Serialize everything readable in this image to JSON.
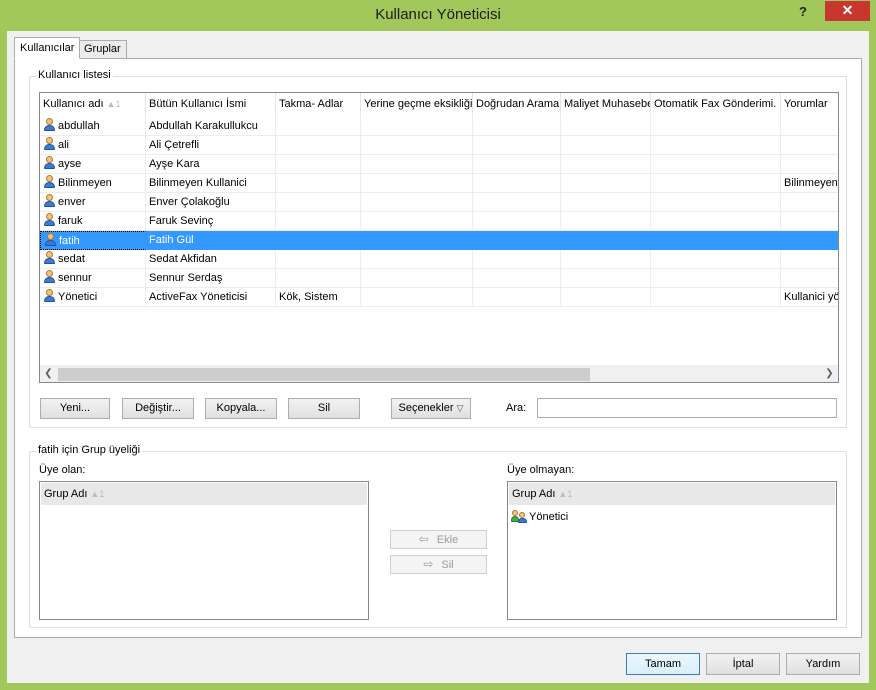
{
  "window": {
    "title": "Kullanıcı Yöneticisi",
    "help_label": "?",
    "close_label": "✕"
  },
  "tabs": [
    {
      "label": "Kullanıcılar",
      "active": true
    },
    {
      "label": "Gruplar",
      "active": false
    }
  ],
  "user_list": {
    "group_label": "Kullanıcı listesi",
    "columns": [
      "Kullanıcı adı",
      "Bütün Kullanıcı İsmi",
      "Takma- Adlar",
      "Yerine geçme eksikliği",
      "Doğrudan Arama",
      "Maliyet Muhasebe",
      "Otomatik Fax Gönderimi.",
      "Yorumlar"
    ],
    "sort_indicator": "▲1",
    "rows": [
      {
        "username": "abdullah",
        "fullname": "Abdullah Karakullukcu",
        "alias": "",
        "comment": ""
      },
      {
        "username": "ali",
        "fullname": "Ali Çetrefli",
        "alias": "",
        "comment": ""
      },
      {
        "username": "ayse",
        "fullname": "Ayşe Kara",
        "alias": "",
        "comment": ""
      },
      {
        "username": "Bilinmeyen",
        "fullname": "Bilinmeyen Kullanici",
        "alias": "",
        "comment": "Bilinmeyen k"
      },
      {
        "username": "enver",
        "fullname": "Enver Çolakoğlu",
        "alias": "",
        "comment": ""
      },
      {
        "username": "faruk",
        "fullname": "Faruk Sevinç",
        "alias": "",
        "comment": ""
      },
      {
        "username": "fatih",
        "fullname": "Fatih Gül",
        "alias": "",
        "comment": "",
        "selected": true
      },
      {
        "username": "sedat",
        "fullname": "Sedat Akfidan",
        "alias": "",
        "comment": ""
      },
      {
        "username": "sennur",
        "fullname": "Sennur Serdaş",
        "alias": "",
        "comment": ""
      },
      {
        "username": "Yönetici",
        "fullname": "ActiveFax Yöneticisi",
        "alias": "Kök, Sistem",
        "comment": "Kullanici yön"
      }
    ]
  },
  "actions": {
    "new": "Yeni...",
    "edit": "Değiştir...",
    "copy": "Kopyala...",
    "delete": "Sil",
    "options": "Seçenekler",
    "search_label": "Ara:",
    "search_value": ""
  },
  "membership": {
    "group_label": "fatih için Grup üyeliği",
    "member_label": "Üye olan:",
    "nonmember_label": "Üye olmayan:",
    "column": "Grup Adı",
    "sort_indicator": "▲1",
    "member_items": [],
    "nonmember_items": [
      "Yönetici"
    ],
    "add_label": "Ekle",
    "remove_label": "Sil"
  },
  "footer": {
    "ok": "Tamam",
    "cancel": "İptal",
    "help": "Yardım"
  }
}
